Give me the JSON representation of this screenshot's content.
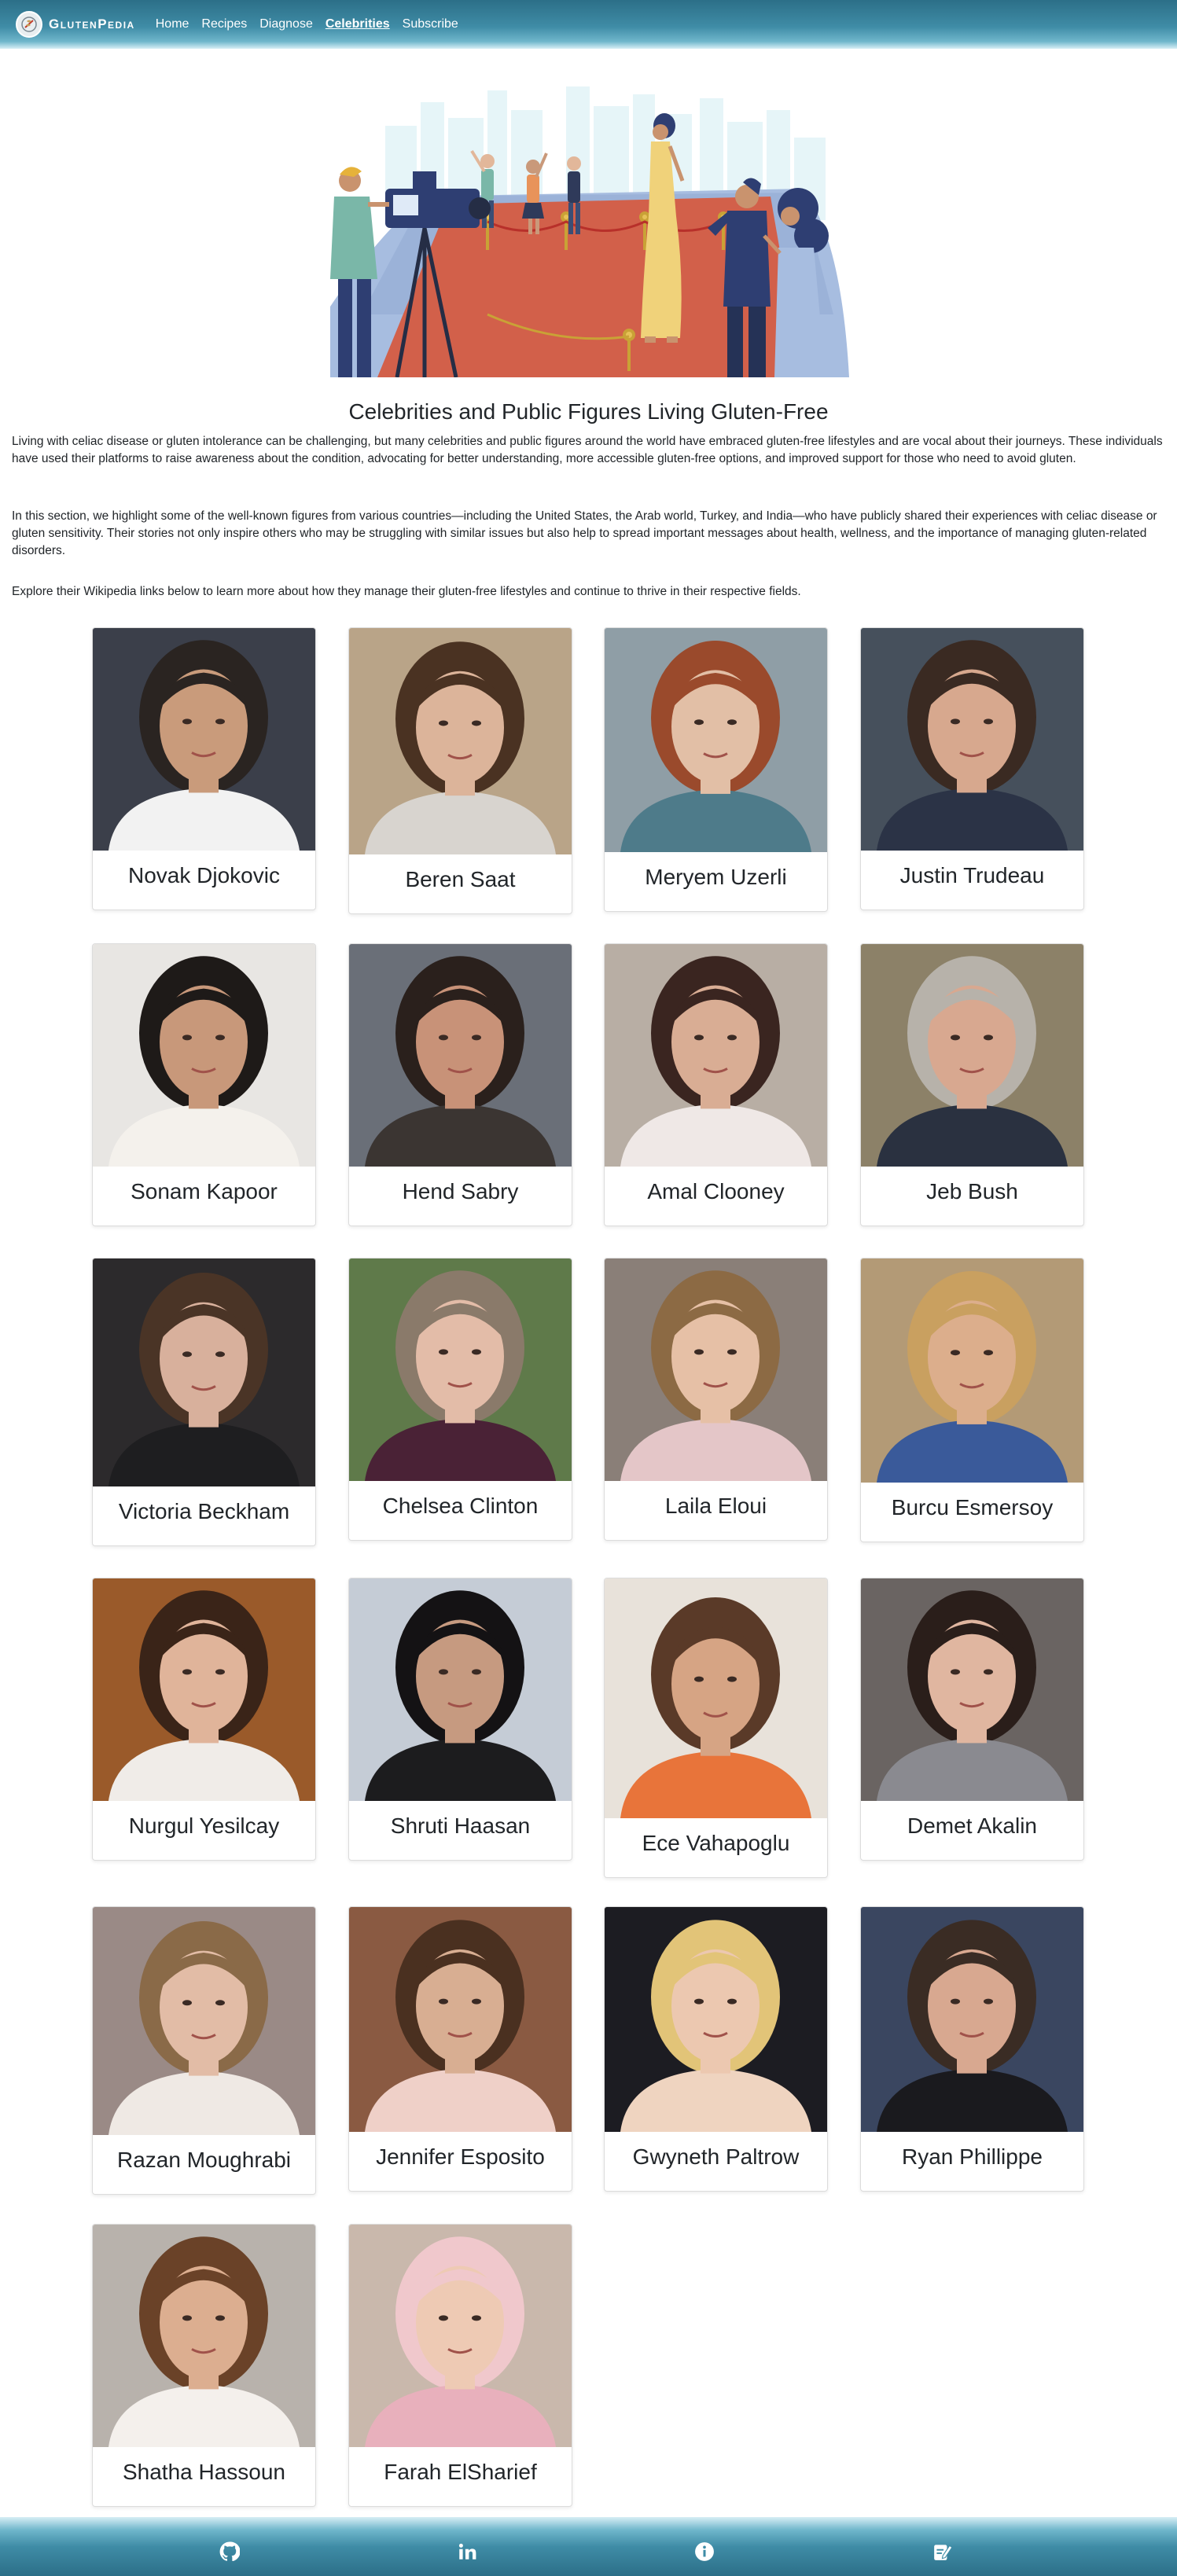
{
  "nav": {
    "brand": "GlutenPedia",
    "links": [
      {
        "label": "Home",
        "active": false
      },
      {
        "label": "Recipes",
        "active": false
      },
      {
        "label": "Diagnose",
        "active": false
      },
      {
        "label": "Celebrities",
        "active": true
      },
      {
        "label": "Subscribe",
        "active": false
      }
    ]
  },
  "page": {
    "title": "Celebrities and Public Figures Living Gluten-Free",
    "paragraphs": [
      "Living with celiac disease or gluten intolerance can be challenging, but many celebrities and public figures around the world have embraced gluten-free lifestyles and are vocal about their journeys. These individuals have used their platforms to raise awareness about the condition, advocating for better understanding, more accessible gluten-free options, and improved support for those who need to avoid gluten.",
      "In this section, we highlight some of the well-known figures from various countries—including the United States, the Arab world, Turkey, and India—who have publicly shared their experiences with celiac disease or gluten sensitivity. Their stories not only inspire others who may be struggling with similar issues but also help to spread important messages about health, wellness, and the importance of managing gluten-related disorders.",
      "Explore their Wikipedia links below to learn more about how they manage their gluten-free lifestyles and continue to thrive in their respective fields."
    ]
  },
  "celebrities": [
    {
      "name": "Novak Djokovic",
      "bg": "#3b3f4a",
      "skin": "#c99b7b",
      "hair": "#2a2421",
      "shirt": "#f2f2f2"
    },
    {
      "name": "Beren Saat",
      "bg": "#b9a488",
      "skin": "#dcb49a",
      "hair": "#4a3222",
      "shirt": "#d8d4cf"
    },
    {
      "name": "Meryem Uzerli",
      "bg": "#8f9ea6",
      "skin": "#e2bfa6",
      "hair": "#9a4a2c",
      "shirt": "#4e7b8a"
    },
    {
      "name": "Justin Trudeau",
      "bg": "#46505c",
      "skin": "#d7a88e",
      "hair": "#3a2a22",
      "shirt": "#2b3346"
    },
    {
      "name": "Sonam Kapoor",
      "bg": "#e8e6e3",
      "skin": "#c8987a",
      "hair": "#1e1a18",
      "shirt": "#f4f1ec"
    },
    {
      "name": "Hend Sabry",
      "bg": "#6a6f78",
      "skin": "#c89278",
      "hair": "#2a201c",
      "shirt": "#3b3532"
    },
    {
      "name": "Amal Clooney",
      "bg": "#b8aea4",
      "skin": "#d9ad94",
      "hair": "#3a2520",
      "shirt": "#efe8e6"
    },
    {
      "name": "Jeb Bush",
      "bg": "#8c8168",
      "skin": "#d8a890",
      "hair": "#b7b2aa",
      "shirt": "#2a3140"
    },
    {
      "name": "Victoria Beckham",
      "bg": "#2c2a2c",
      "skin": "#d8b09c",
      "hair": "#4a3426",
      "shirt": "#1e1e20"
    },
    {
      "name": "Chelsea Clinton",
      "bg": "#5f7a4a",
      "skin": "#e3bca8",
      "hair": "#8a7a6a",
      "shirt": "#4a2236"
    },
    {
      "name": "Laila Eloui",
      "bg": "#8a7f78",
      "skin": "#e6c0a6",
      "hair": "#8c6a44",
      "shirt": "#e4c6c8"
    },
    {
      "name": "Burcu Esmersoy",
      "bg": "#b39a76",
      "skin": "#dcae8c",
      "hair": "#c9a060",
      "shirt": "#3a5a9a"
    },
    {
      "name": "Nurgul Yesilcay",
      "bg": "#9a5a2a",
      "skin": "#e0b49a",
      "hair": "#3a2418",
      "shirt": "#f0ece8"
    },
    {
      "name": "Shruti Haasan",
      "bg": "#c5ccd6",
      "skin": "#c69a80",
      "hair": "#141214",
      "shirt": "#1c1c1e"
    },
    {
      "name": "Ece Vahapoglu",
      "bg": "#e8e2da",
      "skin": "#d6a484",
      "hair": "#5a3a28",
      "shirt": "#e8743a"
    },
    {
      "name": "Demet Akalin",
      "bg": "#6a6462",
      "skin": "#e0b6a0",
      "hair": "#2a1e1a",
      "shirt": "#8a8a90"
    },
    {
      "name": "Razan Moughrabi",
      "bg": "#9a8a86",
      "skin": "#e2bca6",
      "hair": "#8a6a48",
      "shirt": "#efe9e4"
    },
    {
      "name": "Jennifer Esposito",
      "bg": "#8a5a42",
      "skin": "#d8ae92",
      "hair": "#4a3020",
      "shirt": "#efd0c8"
    },
    {
      "name": "Gwyneth Paltrow",
      "bg": "#1c1c22",
      "skin": "#ecc8b0",
      "hair": "#e2c478",
      "shirt": "#efd4c0"
    },
    {
      "name": "Ryan Phillippe",
      "bg": "#3a4660",
      "skin": "#d8a890",
      "hair": "#3a2c24",
      "shirt": "#1a1a1e"
    },
    {
      "name": "Shatha Hassoun",
      "bg": "#b8b2ac",
      "skin": "#dcae90",
      "hair": "#6a4228",
      "shirt": "#f4f0ec"
    },
    {
      "name": "Farah ElSharief",
      "bg": "#c9b8ac",
      "skin": "#eecab4",
      "hair": "#f0c8cc",
      "shirt": "#e8b0bc"
    }
  ],
  "footer": {
    "icons": [
      "github-icon",
      "linkedin-icon",
      "info-icon",
      "edit-note-icon"
    ]
  }
}
